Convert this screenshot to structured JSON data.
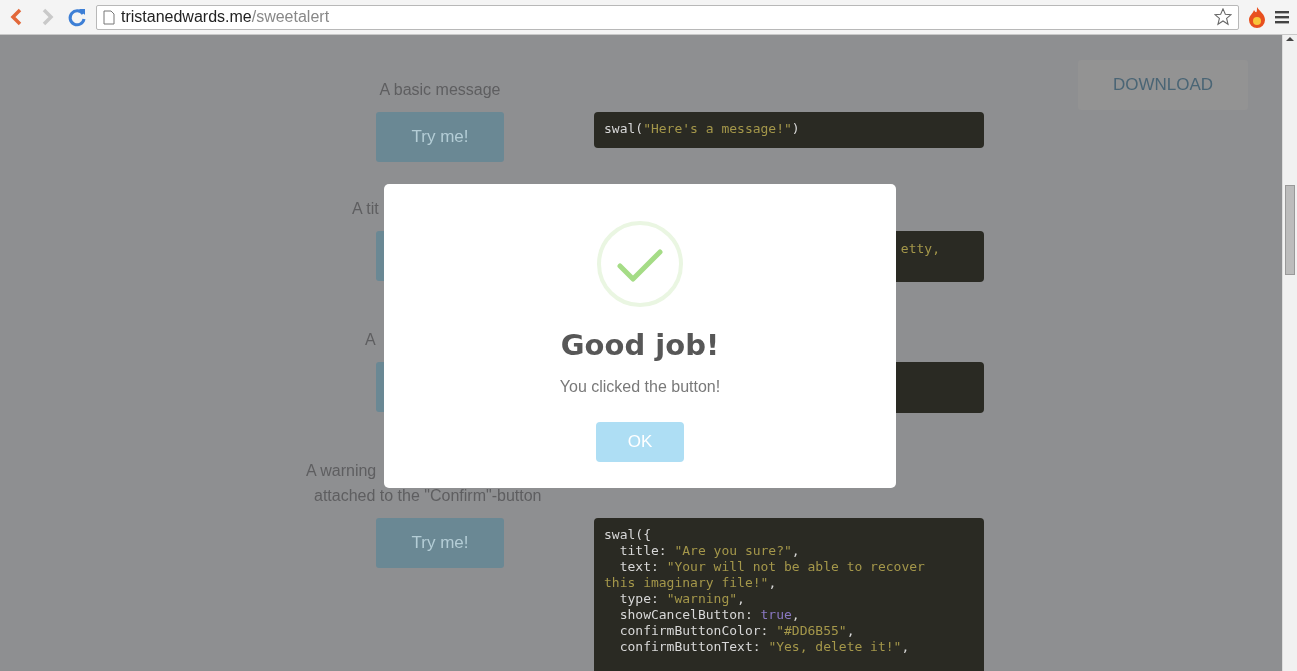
{
  "browser": {
    "url_host": "tristanedwards.me",
    "url_path": "/sweetalert"
  },
  "page": {
    "download": "DOWNLOAD",
    "examples": [
      {
        "label_lines": [
          "A basic message"
        ],
        "button": "Try me!",
        "code_lines": [
          [
            {
              "kind": "plain",
              "text": "swal("
            },
            {
              "kind": "string",
              "text": "\"Here's a message!\""
            },
            {
              "kind": "plain",
              "text": ")"
            }
          ]
        ]
      },
      {
        "label_lines": [
          "A tit"
        ],
        "code_text": "etty,"
      },
      {
        "label_lines": [
          "A"
        ]
      },
      {
        "label_lines": [
          "A warning",
          "attached to the \"Confirm\"-button"
        ],
        "button": "Try me!",
        "code_lines": [
          [
            {
              "kind": "plain",
              "text": "swal({"
            }
          ],
          [
            {
              "kind": "plain",
              "text": "  title: "
            },
            {
              "kind": "string",
              "text": "\"Are you sure?\""
            },
            {
              "kind": "plain",
              "text": ","
            }
          ],
          [
            {
              "kind": "plain",
              "text": "  text: "
            },
            {
              "kind": "string",
              "text": "\"Your will not be able to recover"
            }
          ],
          [
            {
              "kind": "string",
              "text": "this imaginary file!\""
            },
            {
              "kind": "plain",
              "text": ","
            }
          ],
          [
            {
              "kind": "plain",
              "text": "  type: "
            },
            {
              "kind": "string",
              "text": "\"warning\""
            },
            {
              "kind": "plain",
              "text": ","
            }
          ],
          [
            {
              "kind": "plain",
              "text": "  showCancelButton: "
            },
            {
              "kind": "keyword",
              "text": "true"
            },
            {
              "kind": "plain",
              "text": ","
            }
          ],
          [
            {
              "kind": "plain",
              "text": "  confirmButtonColor: "
            },
            {
              "kind": "string",
              "text": "\"#DD6B55\""
            },
            {
              "kind": "plain",
              "text": ","
            }
          ],
          [
            {
              "kind": "plain",
              "text": "  confirmButtonText: "
            },
            {
              "kind": "string",
              "text": "\"Yes, delete it!\""
            },
            {
              "kind": "plain",
              "text": ","
            }
          ]
        ]
      }
    ]
  },
  "dialog": {
    "title": "Good job!",
    "text": "You clicked the button!",
    "button": "OK"
  }
}
